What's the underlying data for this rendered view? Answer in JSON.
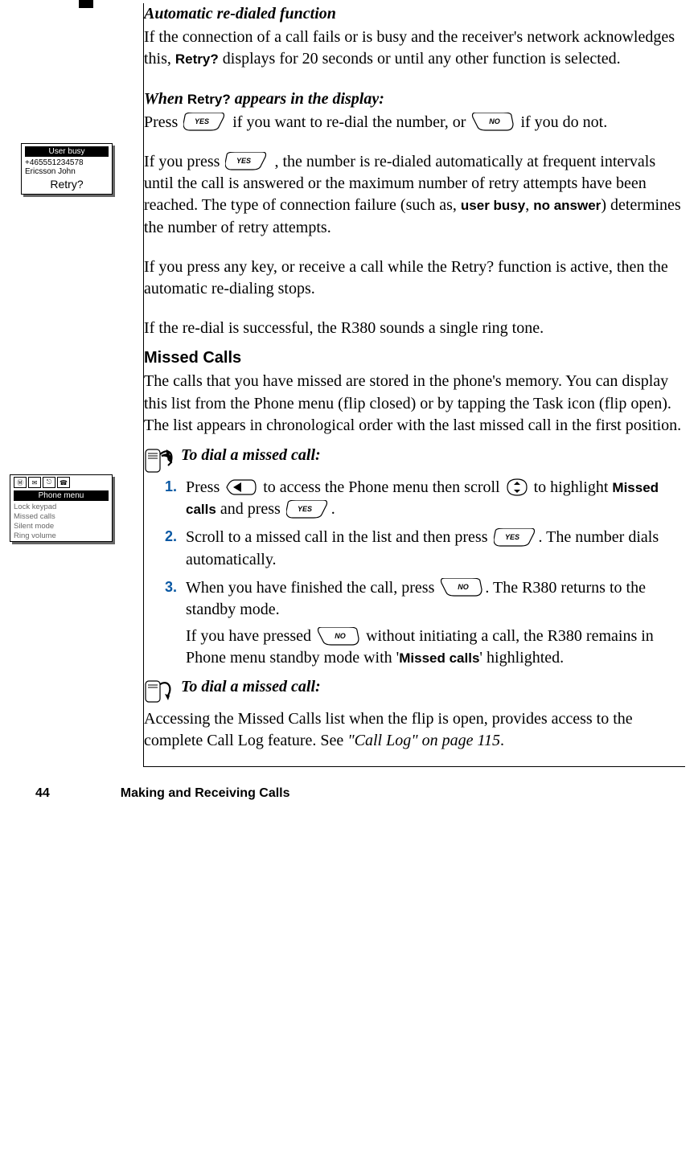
{
  "section": {
    "title": "Automatic re-dialed function",
    "p1_a": "If the connection of a call fails or is busy and the receiver's network acknowledges this, ",
    "p1_retry": "Retry?",
    "p1_b": " displays for 20 seconds or until any other function is selected.",
    "when_a": "When ",
    "when_retry": "Retry?",
    "when_b": " appears in the display:",
    "press_a": "Press ",
    "press_b": " if you want to re-dial the number, or ",
    "press_c": " if you do not.",
    "ifyes_a": "If you press ",
    "ifyes_b": ", the number is re-dialed automatically at frequent intervals until the call is answered or the maximum number of retry attempts have been reached. The type of connection failure (such as, ",
    "ifyes_ub": "user busy",
    "ifyes_sep": ", ",
    "ifyes_na": "no answer",
    "ifyes_c": ") determines the number of retry attempts.",
    "anykey": "If you press any key, or receive a call while the Retry? function is active, then the automatic re-dialing stops.",
    "success": "If the re-dial is successful, the R380 sounds a single ring tone."
  },
  "retry_screen": {
    "head": "User busy",
    "number": "+465551234578",
    "name": "Ericsson John",
    "prompt": "Retry?"
  },
  "missed": {
    "title": "Missed Calls",
    "intro": "The calls that you have missed are stored in the phone's memory. You can display this list from the Phone menu (flip closed) or by tapping the Task icon (flip open). The list appears in chronological order with the last missed call in the first position.",
    "proc1_title": "To dial a missed call:",
    "steps": [
      {
        "a": "Press ",
        "b": " to access the Phone menu then scroll ",
        "c": " to highlight ",
        "missed": "Missed calls",
        "d": " and press ",
        "e": "."
      },
      {
        "a": "Scroll to a missed call in the list and then press ",
        "b": ". The number dials automatically."
      },
      {
        "a": "When you have finished the call, press ",
        "b": ". The R380 returns to the standby mode.",
        "note_a": "If you have pressed ",
        "note_b": " without initiating a call, the R380 remains in Phone menu standby mode with '",
        "note_missed": "Missed calls",
        "note_c": "' highlighted."
      }
    ],
    "proc2_title": "To dial a missed call:",
    "flipopen_a": "Accessing the Missed Calls list when the flip is open, provides access to the complete Call Log feature. See ",
    "flipopen_ref": "\"Call Log\" on page 115",
    "flipopen_b": "."
  },
  "phone_menu_screen": {
    "head": "Phone menu",
    "items": [
      "Lock keypad",
      "Missed calls",
      "Silent mode",
      "Ring volume"
    ]
  },
  "key_labels": {
    "yes": "YES",
    "no": "NO"
  },
  "footer": {
    "page": "44",
    "chapter": "Making and Receiving Calls"
  }
}
